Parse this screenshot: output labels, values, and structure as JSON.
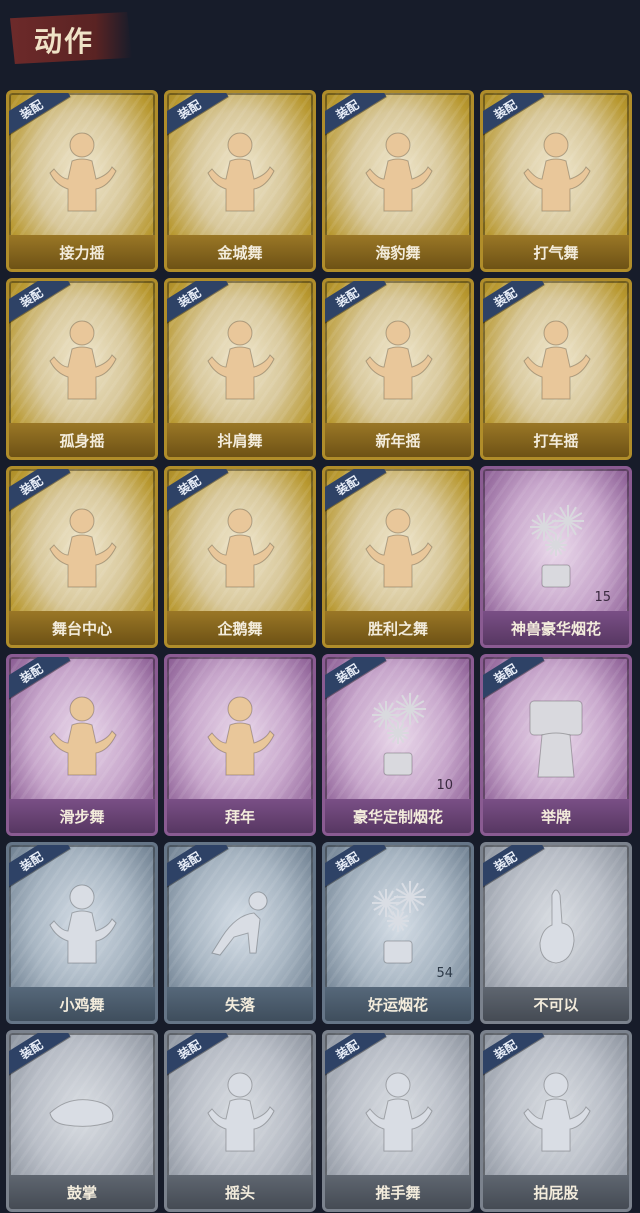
{
  "header": {
    "title": "动作"
  },
  "badge_text": "装配",
  "cards": [
    {
      "label": "接力摇",
      "tier": "gold",
      "icon": "dance-figure-icon",
      "badge": true
    },
    {
      "label": "金城舞",
      "tier": "gold",
      "icon": "dance-figure-icon",
      "badge": true
    },
    {
      "label": "海豹舞",
      "tier": "gold",
      "icon": "dance-figure-icon",
      "badge": true
    },
    {
      "label": "打气舞",
      "tier": "gold",
      "icon": "dance-figure-icon",
      "badge": true
    },
    {
      "label": "孤身摇",
      "tier": "gold",
      "icon": "dance-figure-icon",
      "badge": true
    },
    {
      "label": "抖肩舞",
      "tier": "gold",
      "icon": "dance-figure-icon",
      "badge": true
    },
    {
      "label": "新年摇",
      "tier": "gold",
      "icon": "dance-figure-icon",
      "badge": true
    },
    {
      "label": "打车摇",
      "tier": "gold",
      "icon": "dance-figure-icon",
      "badge": true
    },
    {
      "label": "舞台中心",
      "tier": "gold",
      "icon": "dance-figure-icon",
      "badge": true
    },
    {
      "label": "企鹅舞",
      "tier": "gold",
      "icon": "dance-figure-icon",
      "badge": true
    },
    {
      "label": "胜利之舞",
      "tier": "gold",
      "icon": "dance-figure-icon",
      "badge": true
    },
    {
      "label": "神兽豪华烟花",
      "tier": "purple",
      "icon": "fireworks-icon",
      "badge": false,
      "count": "15"
    },
    {
      "label": "滑步舞",
      "tier": "purple",
      "icon": "dance-figure-icon",
      "badge": true
    },
    {
      "label": "拜年",
      "tier": "purple",
      "icon": "dance-figure-icon",
      "badge": false
    },
    {
      "label": "豪华定制烟花",
      "tier": "purple",
      "icon": "fireworks-icon",
      "badge": true,
      "count": "10"
    },
    {
      "label": "举牌",
      "tier": "purple",
      "icon": "sign-figure-icon",
      "badge": true
    },
    {
      "label": "小鸡舞",
      "tier": "blue",
      "icon": "dance-figure-icon",
      "badge": true
    },
    {
      "label": "失落",
      "tier": "blue",
      "icon": "crawl-figure-icon",
      "badge": true
    },
    {
      "label": "好运烟花",
      "tier": "blue",
      "icon": "fireworks-icon",
      "badge": true,
      "count": "54"
    },
    {
      "label": "不可以",
      "tier": "grey",
      "icon": "finger-wag-icon",
      "badge": true
    },
    {
      "label": "鼓掌",
      "tier": "grey",
      "icon": "clap-icon",
      "badge": true
    },
    {
      "label": "摇头",
      "tier": "grey",
      "icon": "dance-figure-icon",
      "badge": true
    },
    {
      "label": "推手舞",
      "tier": "grey",
      "icon": "dance-figure-icon",
      "badge": true
    },
    {
      "label": "拍屁股",
      "tier": "grey",
      "icon": "dance-figure-icon",
      "badge": true
    }
  ]
}
